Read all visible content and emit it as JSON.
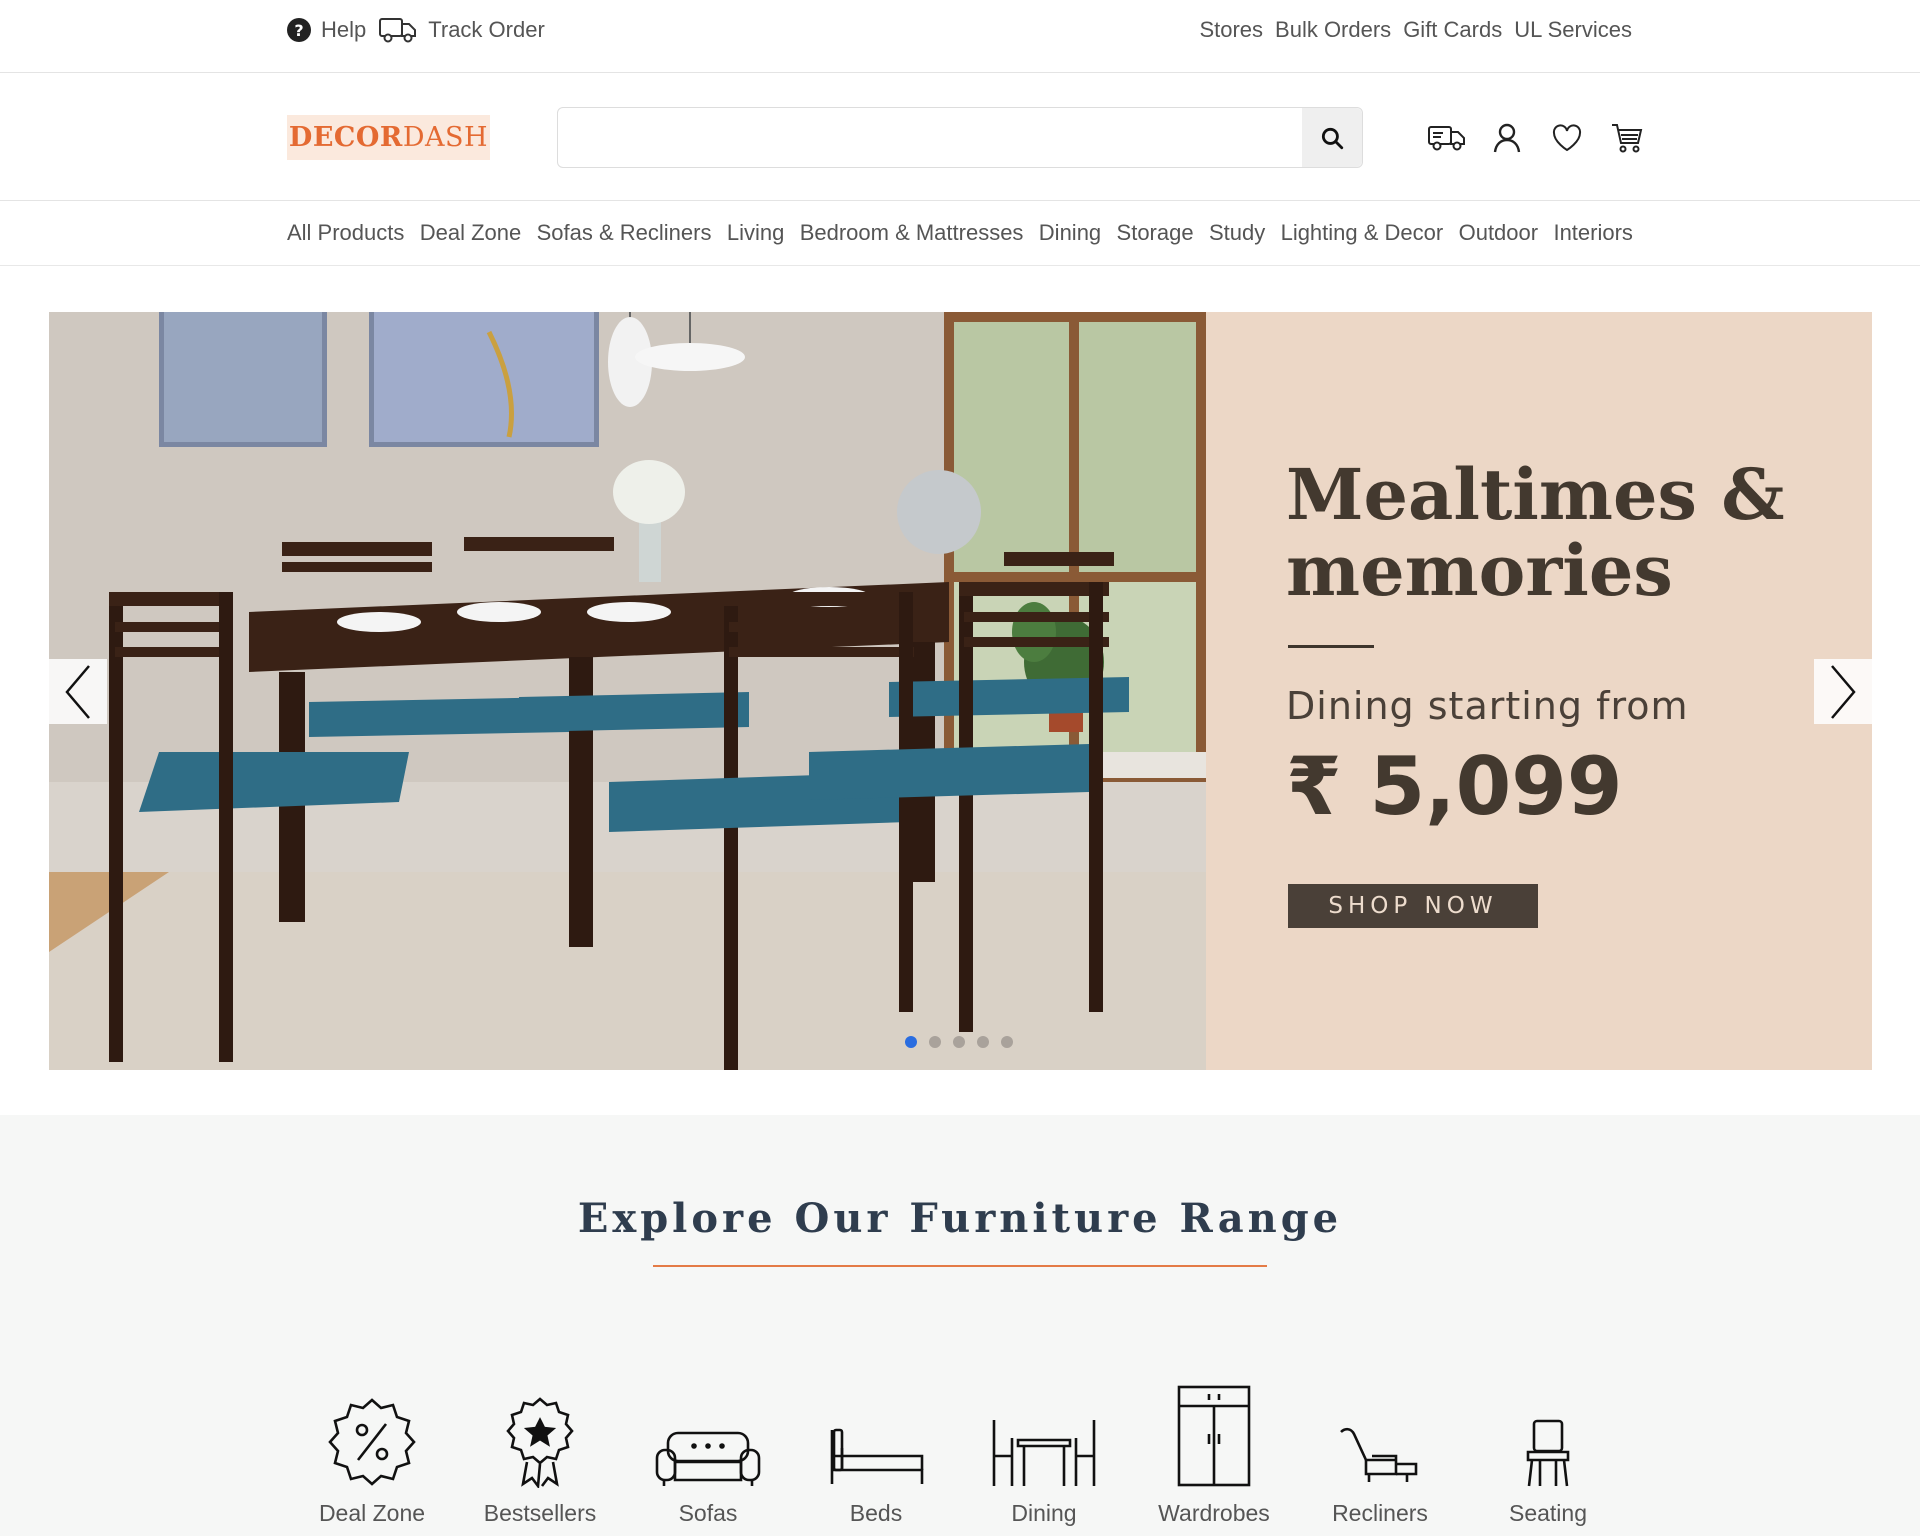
{
  "topbar": {
    "help": "Help",
    "track_order": "Track Order",
    "links": [
      "Stores",
      "Bulk Orders",
      "Gift Cards",
      "UL Services"
    ]
  },
  "header": {
    "logo_part1": "DECOR",
    "logo_part2": "DASH",
    "search_placeholder": "",
    "icons": [
      "delivery-truck-icon",
      "user-icon",
      "heart-icon",
      "cart-icon"
    ]
  },
  "categories_nav": [
    "All Products",
    "Deal Zone",
    "Sofas & Recliners",
    "Living",
    "Bedroom & Mattresses",
    "Dining",
    "Storage",
    "Study",
    "Lighting & Decor",
    "Outdoor",
    "Interiors"
  ],
  "hero": {
    "title_line1": "Mealtimes &",
    "title_line2": "memories",
    "subtitle": "Dining starting from",
    "price": "₹ 5,099",
    "cta": "SHOP NOW",
    "slides_total": 5,
    "active_slide": 1
  },
  "explore": {
    "title": "Explore Our Furniture Range",
    "items": [
      {
        "label": "Deal Zone",
        "icon": "discount-badge-icon"
      },
      {
        "label": "Bestsellers",
        "icon": "award-ribbon-icon"
      },
      {
        "label": "Sofas",
        "icon": "sofa-icon"
      },
      {
        "label": "Beds",
        "icon": "bed-icon"
      },
      {
        "label": "Dining",
        "icon": "dining-table-icon"
      },
      {
        "label": "Wardrobes",
        "icon": "wardrobe-icon"
      },
      {
        "label": "Recliners",
        "icon": "recliner-icon"
      },
      {
        "label": "Seating",
        "icon": "chair-icon"
      }
    ]
  },
  "colors": {
    "brand": "#e46a32",
    "hero_panel": "#ecd7c6",
    "cta_bg": "#4a4038",
    "active_dot": "#2a6de0",
    "accent_rule": "#e47b46"
  }
}
